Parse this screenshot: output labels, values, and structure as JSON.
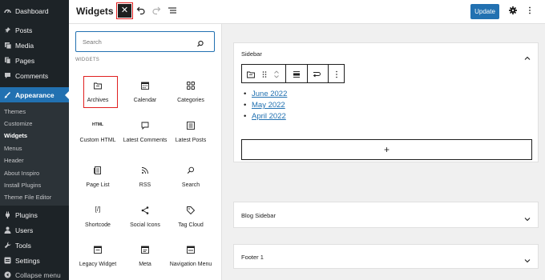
{
  "admin_menu": {
    "items": [
      {
        "label": "Dashboard",
        "icon": "dashboard-icon"
      },
      {
        "label": "Posts",
        "icon": "pin-icon"
      },
      {
        "label": "Media",
        "icon": "media-icon"
      },
      {
        "label": "Pages",
        "icon": "pages-icon"
      },
      {
        "label": "Comments",
        "icon": "comment-icon"
      },
      {
        "label": "Appearance",
        "icon": "brush-icon"
      },
      {
        "label": "Plugins",
        "icon": "plug-icon"
      },
      {
        "label": "Users",
        "icon": "user-icon"
      },
      {
        "label": "Tools",
        "icon": "wrench-icon"
      },
      {
        "label": "Settings",
        "icon": "settings-icon"
      },
      {
        "label": "Collapse menu",
        "icon": "collapse-icon"
      }
    ],
    "submenu": [
      "Themes",
      "Customize",
      "Widgets",
      "Menus",
      "Header",
      "About Inspiro",
      "Install Plugins",
      "Theme File Editor"
    ],
    "current_submenu": "Widgets"
  },
  "toolbar": {
    "title": "Widgets",
    "close_symbol": "✕",
    "undo_icon": "undo-icon",
    "redo_icon": "redo-icon",
    "list_view_icon": "list-view-icon",
    "update_label": "Update",
    "settings_icon": "gear-icon",
    "options_icon": "more-options-icon"
  },
  "inserter": {
    "search_placeholder": "Search",
    "section_label": "WIDGETS",
    "blocks": [
      {
        "label": "Archives",
        "icon": "archive-folder-icon"
      },
      {
        "label": "Calendar",
        "icon": "calendar-icon"
      },
      {
        "label": "Categories",
        "icon": "categories-icon"
      },
      {
        "label": "Custom HTML",
        "icon": "html-icon"
      },
      {
        "label": "Latest Comments",
        "icon": "comment-bubble-icon"
      },
      {
        "label": "Latest Posts",
        "icon": "posts-list-icon"
      },
      {
        "label": "Page List",
        "icon": "page-list-icon"
      },
      {
        "label": "RSS",
        "icon": "rss-icon"
      },
      {
        "label": "Search",
        "icon": "search-icon"
      },
      {
        "label": "Shortcode",
        "icon": "shortcode-icon"
      },
      {
        "label": "Social Icons",
        "icon": "share-icon"
      },
      {
        "label": "Tag Cloud",
        "icon": "tag-icon"
      },
      {
        "label": "Legacy Widget",
        "icon": "widget-icon"
      },
      {
        "label": "Meta",
        "icon": "meta-icon"
      },
      {
        "label": "Navigation Menu",
        "icon": "navigation-icon"
      }
    ],
    "html_icon_text": "HTML",
    "shortcode_icon_text": "[/]"
  },
  "canvas": {
    "areas": [
      {
        "title": "Sidebar",
        "expanded": true
      },
      {
        "title": "Blog Sidebar",
        "expanded": false
      },
      {
        "title": "Footer 1",
        "expanded": false
      }
    ],
    "archive_links": [
      "June 2022",
      "May 2022",
      "April 2022"
    ],
    "add_block_symbol": "+"
  },
  "colors": {
    "admin_bg": "#1d2327",
    "accent": "#2271b1",
    "highlight": "#e02020"
  }
}
